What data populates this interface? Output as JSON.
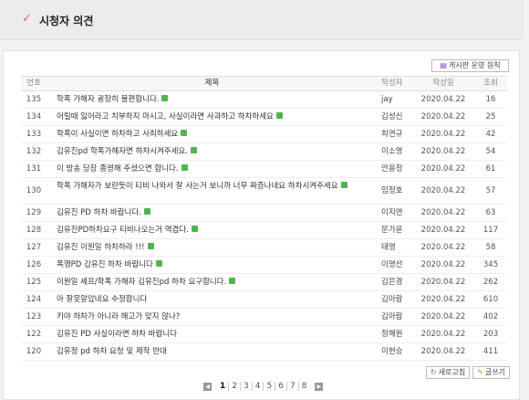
{
  "header": {
    "title": "시청자 의견",
    "check_icon": "checkmark-icon"
  },
  "rules_button": {
    "icon": "document-icon",
    "label": "게시판 운영 원칙"
  },
  "table": {
    "columns": {
      "no": "번호",
      "title": "제목",
      "author": "작성자",
      "date": "작성일",
      "views": "조회"
    },
    "rows": [
      {
        "no": "135",
        "title": "학폭 가해자 굉장히 불편합니다.",
        "new": true,
        "author": "jay",
        "date": "2020.04.22",
        "views": "16"
      },
      {
        "no": "134",
        "title": "어릴때 잃어라고 치부하지 마시고, 사실이라면 사과하고 하차하세요",
        "new": true,
        "author": "김성신",
        "date": "2020.04.22",
        "views": "25"
      },
      {
        "no": "133",
        "title": "학폭이 사실이면 하차하고 사죄하세요",
        "new": true,
        "author": "최연규",
        "date": "2020.04.22",
        "views": "42"
      },
      {
        "no": "132",
        "title": "김유진pd 학폭가해자면 하차시켜주세요.",
        "new": true,
        "author": "이소영",
        "date": "2020.04.22",
        "views": "54"
      },
      {
        "no": "131",
        "title": "이 방송 당장 종영해 주셨으면 합니다.",
        "new": true,
        "author": "안용정",
        "date": "2020.04.22",
        "views": "61"
      },
      {
        "no": "130",
        "title": "학폭 가해자가 보란듯이 티비 나와서 잘 사는거 보니까 너무 짜증나네요 하차시켜주세요",
        "new": true,
        "author": "임정호",
        "date": "2020.04.22",
        "views": "57",
        "tall": true
      },
      {
        "no": "129",
        "title": "김유진 PD 하차 바랍니다.",
        "new": true,
        "author": "이지연",
        "date": "2020.04.22",
        "views": "63"
      },
      {
        "no": "128",
        "title": "김유진PD하차요구 티비나오는거 역겹다.",
        "new": true,
        "author": "문가윤",
        "date": "2020.04.22",
        "views": "117"
      },
      {
        "no": "127",
        "title": "김유진 이원일 하차하라 !!!",
        "new": true,
        "author": "태영",
        "date": "2020.04.22",
        "views": "58"
      },
      {
        "no": "126",
        "title": "폭행PD 김유진 하차 바랍니다",
        "new": true,
        "author": "이영선",
        "date": "2020.04.22",
        "views": "345"
      },
      {
        "no": "125",
        "title": "이원일 셰프/학폭 가해자 김유진pd 하차 요구합니다.",
        "new": true,
        "author": "김은경",
        "date": "2020.04.22",
        "views": "262"
      },
      {
        "no": "124",
        "title": "아 잘못알았네요 수정합니다",
        "new": false,
        "author": "김아람",
        "date": "2020.04.22",
        "views": "610"
      },
      {
        "no": "123",
        "title": "키야 하차가 아니라 해고가 맞지 않나?",
        "new": false,
        "author": "김아람",
        "date": "2020.04.22",
        "views": "402"
      },
      {
        "no": "122",
        "title": "김유진 PD 사실이라면 하차 바랍니다",
        "new": false,
        "author": "정혜원",
        "date": "2020.04.22",
        "views": "203"
      },
      {
        "no": "120",
        "title": "김유정 pd 하차 요청 및 제작 반대",
        "new": false,
        "author": "이현승",
        "date": "2020.04.22",
        "views": "411"
      }
    ]
  },
  "actions": {
    "refresh_label": "새로고침",
    "write_label": "글쓰기",
    "refresh_icon": "refresh-icon",
    "write_icon": "pencil-icon"
  },
  "pagination": {
    "pages": [
      "1",
      "2",
      "3",
      "4",
      "5",
      "6",
      "7",
      "8"
    ],
    "current": "1",
    "prev_icon": "prev-arrow-icon",
    "next_icon": "next-arrow-icon"
  },
  "colors": {
    "accent_check": "#e35a7a",
    "new_badge": "#53b34f"
  }
}
